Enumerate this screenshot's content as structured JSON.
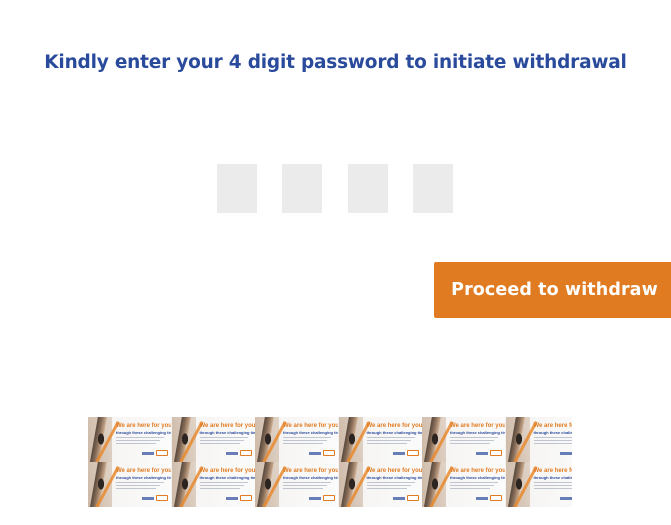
{
  "prompt": {
    "title": "Kindly enter your 4 digit password to initiate withdrawal"
  },
  "pin": {
    "digits": [
      "",
      "",
      "",
      ""
    ],
    "length": 4
  },
  "actions": {
    "proceed_label": "Proceed to withdraw"
  },
  "banner": {
    "headline": "We are here for you",
    "subheadline": "through these challenging times",
    "tile_count": 12
  },
  "colors": {
    "title": "#2a4a9c",
    "button": "#e07b22",
    "pin_box": "#ebebeb"
  }
}
